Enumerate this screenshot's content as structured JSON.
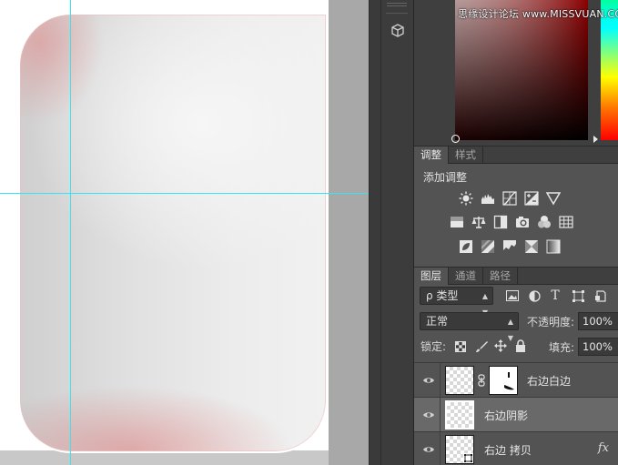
{
  "watermark": "思缘设计论坛 www.MISSVUAN.COM",
  "toolbar": {
    "expand_glyph": "»",
    "tool_3d_icon": "3d-cube-icon"
  },
  "adjustments_panel": {
    "tabs": [
      {
        "label": "调整",
        "active": true
      },
      {
        "label": "样式",
        "active": false
      }
    ],
    "title": "添加调整",
    "icon_rows": [
      [
        "brightness-contrast-icon",
        "levels-icon",
        "curves-icon",
        "exposure-icon",
        "vibrance-icon"
      ],
      [
        "hue-saturation-icon",
        "color-balance-icon",
        "black-white-icon",
        "photo-filter-icon",
        "channel-mixer-icon",
        "color-lookup-icon"
      ],
      [
        "invert-icon",
        "posterize-icon",
        "threshold-icon",
        "selective-color-icon",
        "gradient-map-icon"
      ]
    ]
  },
  "layers_panel": {
    "tabs": [
      {
        "label": "图层",
        "active": true
      },
      {
        "label": "通道",
        "active": false
      },
      {
        "label": "路径",
        "active": false
      }
    ],
    "filter_kind": "ρ 类型",
    "filter_icons": [
      "pixel-filter-icon",
      "adjustment-filter-icon",
      "type-filter-icon",
      "shape-filter-icon",
      "smart-object-filter-icon"
    ],
    "blend_mode": "正常",
    "opacity_label": "不透明度:",
    "opacity_value": "100%",
    "lock_label": "锁定:",
    "lock_icons": [
      "lock-transparent-icon",
      "lock-image-icon",
      "lock-position-icon",
      "lock-all-icon"
    ],
    "fill_label": "填充:",
    "fill_value": "100%",
    "layers": [
      {
        "name": "右边白边",
        "has_mask": true,
        "selected": false,
        "fx": ""
      },
      {
        "name": "右边阴影",
        "has_mask": false,
        "selected": true,
        "fx": ""
      },
      {
        "name": "右边 拷贝",
        "has_mask": false,
        "selected": false,
        "fx": "fx"
      }
    ]
  },
  "colors": {
    "panel_bg": "#535353",
    "guide": "#33e6f0",
    "selected_layer": "#696969"
  }
}
